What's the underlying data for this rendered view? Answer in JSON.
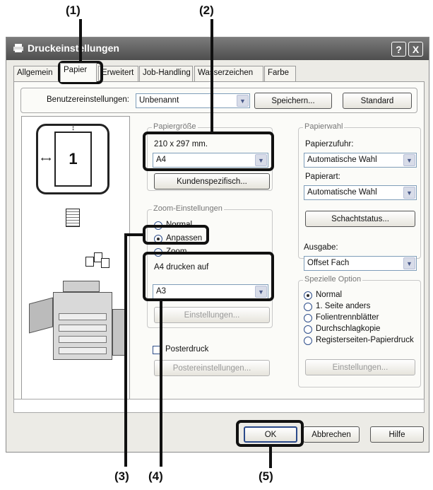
{
  "callouts": {
    "c1": "(1)",
    "c2": "(2)",
    "c3": "(3)",
    "c4": "(4)",
    "c5": "(5)"
  },
  "window": {
    "title": "Druckeinstellungen",
    "help_button": "?",
    "close_button": "X"
  },
  "tabs": [
    {
      "label": "Allgemein"
    },
    {
      "label": "Papier"
    },
    {
      "label": "Erweitert"
    },
    {
      "label": "Job-Handling"
    },
    {
      "label": "Wasserzeichen"
    },
    {
      "label": "Farbe"
    }
  ],
  "user_settings": {
    "label": "Benutzereinstellungen:",
    "value": "Unbenannt",
    "save_button": "Speichern...",
    "default_button": "Standard"
  },
  "preview": {
    "page_number": "1"
  },
  "paper_size": {
    "group_title": "Papiergröße",
    "dimensions": "210 x 297 mm.",
    "value": "A4",
    "custom_button": "Kundenspezifisch..."
  },
  "zoom": {
    "group_title": "Zoom-Einstellungen",
    "option_normal": "Normal",
    "option_fit": "Anpassen",
    "option_zoom": "Zoom",
    "print_on_label": "A4 drucken auf",
    "print_on_value": "A3",
    "settings_button": "Einstellungen..."
  },
  "poster": {
    "label": "Posterdruck",
    "settings_button": "Postereinstellungen..."
  },
  "paper_choice": {
    "group_title": "Papierwahl",
    "feed_label": "Papierzufuhr:",
    "feed_value": "Automatische Wahl",
    "type_label": "Papierart:",
    "type_value": "Automatische Wahl",
    "tray_status_button": "Schachtstatus..."
  },
  "output": {
    "label": "Ausgabe:",
    "value": "Offset Fach"
  },
  "special_option": {
    "group_title": "Spezielle Option",
    "options": [
      "Normal",
      "1. Seite anders",
      "Folientrennblätter",
      "Durchschlagkopie",
      "Registerseiten-Papierdruck"
    ],
    "settings_button": "Einstellungen..."
  },
  "footer": {
    "ok_button": "OK",
    "cancel_button": "Abbrechen",
    "help_button": "Hilfe"
  }
}
